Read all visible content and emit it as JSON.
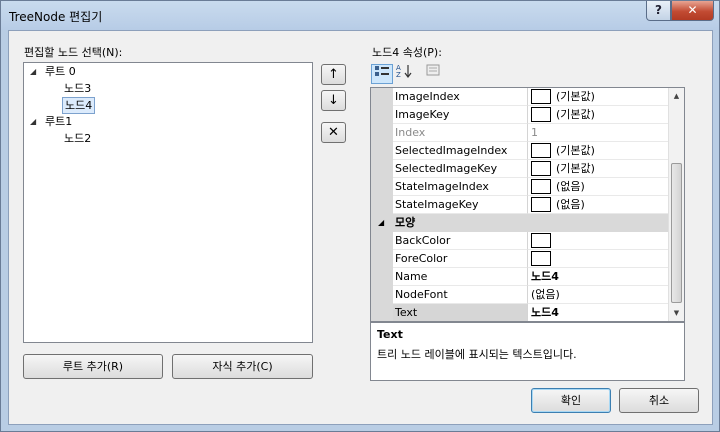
{
  "window": {
    "title": "TreeNode 편집기",
    "help_glyph": "?",
    "close_glyph": "✕"
  },
  "tree_panel": {
    "label": "편집할 노드 선택(N):",
    "nodes": [
      {
        "label": "루트 0",
        "expander": "◢",
        "children": [
          {
            "label": "노드3"
          },
          {
            "label": "노드4",
            "selected": true
          }
        ]
      },
      {
        "label": "루트1",
        "expander": "◢",
        "children": [
          {
            "label": "노드2"
          }
        ]
      }
    ],
    "add_root_label": "루트 추가(R)",
    "add_child_label": "자식 추가(C)"
  },
  "move_buttons": {
    "up": "↑",
    "down": "↓",
    "delete": "✕"
  },
  "properties_panel": {
    "label": "노드4 속성(P):",
    "toolbar": {
      "categorized_icon": "categorized-icon",
      "alphabetical_icon": "alphabetical-icon",
      "pages_icon": "property-pages-icon"
    },
    "rows_before": [
      {
        "name": "ImageIndex",
        "value": "(기본값)",
        "swatch": true
      },
      {
        "name": "ImageKey",
        "value": "(기본값)",
        "swatch": true
      },
      {
        "name": "Index",
        "value": "1",
        "disabled": true
      },
      {
        "name": "SelectedImageIndex",
        "value": "(기본값)",
        "swatch": true
      },
      {
        "name": "SelectedImageKey",
        "value": "(기본값)",
        "swatch": true
      },
      {
        "name": "StateImageIndex",
        "value": "(없음)",
        "swatch": true
      },
      {
        "name": "StateImageKey",
        "value": "(없음)",
        "swatch": true
      }
    ],
    "category": {
      "label": "모양",
      "expander": "◢"
    },
    "rows_after": [
      {
        "name": "BackColor",
        "value": "",
        "swatch": true
      },
      {
        "name": "ForeColor",
        "value": "",
        "swatch": true
      },
      {
        "name": "Name",
        "value": "노드4",
        "bold": true
      },
      {
        "name": "NodeFont",
        "value": "(없음)"
      },
      {
        "name": "Text",
        "value": "노드4",
        "bold": true,
        "selected": true
      }
    ],
    "description": {
      "title": "Text",
      "text": "트리 노드 레이블에 표시되는 텍스트입니다."
    }
  },
  "footer": {
    "ok_label": "확인",
    "cancel_label": "취소"
  }
}
